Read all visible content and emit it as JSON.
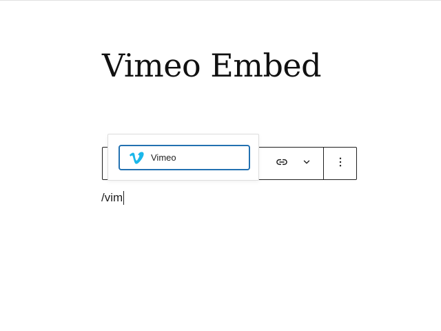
{
  "editor": {
    "title": "Vimeo Embed",
    "paragraph_text": "/vim"
  },
  "autocomplete": {
    "options": [
      {
        "label": "Vimeo",
        "icon": "vimeo-icon"
      }
    ]
  },
  "toolbar": {
    "buttons": [
      "link-icon",
      "chevron-down-icon",
      "more-vertical-icon"
    ]
  },
  "colors": {
    "accent": "#2271b1",
    "vimeo_brand": "#1ab7ea",
    "text": "#1e1e1e"
  }
}
